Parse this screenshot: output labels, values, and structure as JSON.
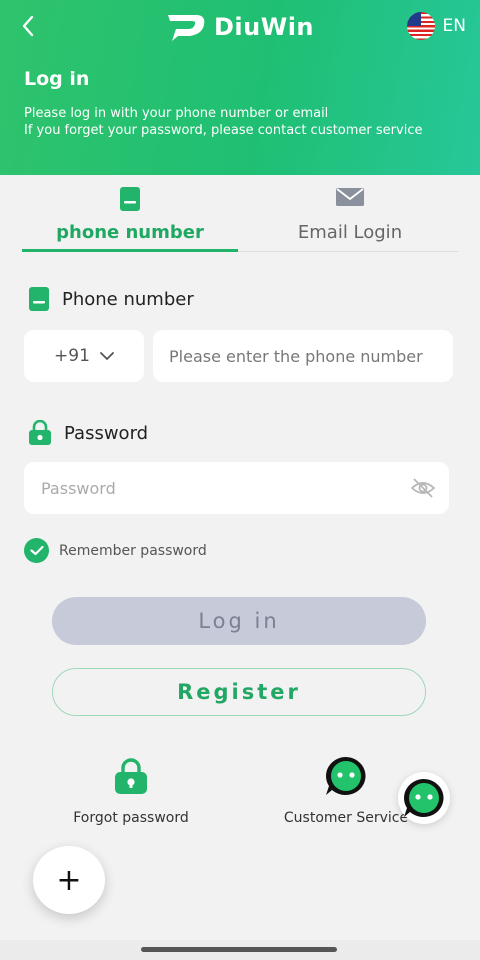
{
  "header": {
    "brand": "DiuWin",
    "language": "EN",
    "title": "Log in",
    "subtitle_line1": "Please log in with your phone number or email",
    "subtitle_line2": "If you forget your password, please contact customer service"
  },
  "tabs": [
    {
      "label": "phone number",
      "active": true
    },
    {
      "label": "Email Login",
      "active": false
    }
  ],
  "phone": {
    "label": "Phone number",
    "country_code": "+91",
    "placeholder": "Please enter the phone number"
  },
  "password": {
    "label": "Password",
    "placeholder": "Password"
  },
  "remember": {
    "label": "Remember password",
    "checked": true
  },
  "buttons": {
    "login": "Log in",
    "register": "Register"
  },
  "links": {
    "forgot": "Forgot password",
    "service": "Customer Service"
  },
  "fab": {
    "symbol": "+"
  },
  "colors": {
    "brand": "#22b46a",
    "header_start": "#2fc36c",
    "header_end": "#27c79a",
    "login_disabled": "#c6cad9"
  }
}
